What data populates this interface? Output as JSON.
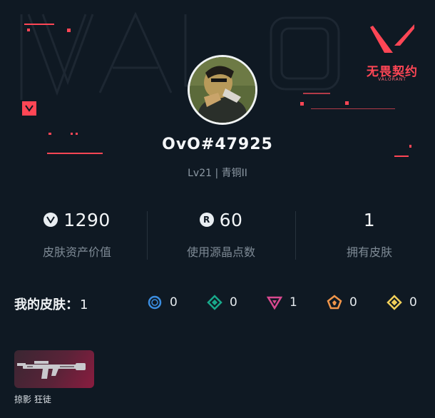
{
  "brand": {
    "name_cn": "无畏契约",
    "name_en": "VALORANT",
    "accent": "#ff4655"
  },
  "profile": {
    "username": "OvO#47925",
    "level": "Lv21 | 青铜II"
  },
  "stats": [
    {
      "icon": "valorant-points-icon",
      "value": "1290",
      "label": "皮肤资产价值"
    },
    {
      "icon": "radianite-icon",
      "value": "60",
      "label": "使用源晶点数"
    },
    {
      "icon": "",
      "value": "1",
      "label": "拥有皮肤"
    }
  ],
  "skins": {
    "title": "我的皮肤：",
    "count": "1",
    "tiers": [
      {
        "icon": "select-tier-icon",
        "color": "#3b8de0",
        "count": "0"
      },
      {
        "icon": "deluxe-tier-icon",
        "color": "#19a98b",
        "count": "0"
      },
      {
        "icon": "premium-tier-icon",
        "color": "#d8488f",
        "count": "1"
      },
      {
        "icon": "exclusive-tier-icon",
        "color": "#f0954a",
        "count": "0"
      },
      {
        "icon": "ultra-tier-icon",
        "color": "#f1d05a",
        "count": "0"
      }
    ],
    "items": [
      {
        "name": "掠影 狂徒",
        "icon": "vandal-rifle-icon"
      }
    ]
  }
}
